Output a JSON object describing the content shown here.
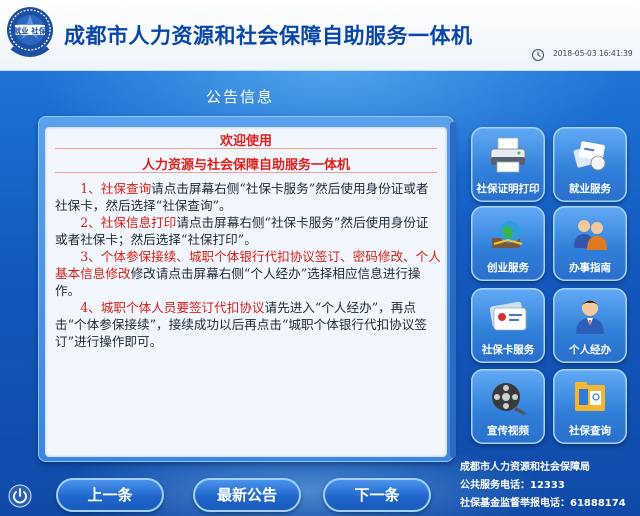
{
  "header": {
    "logo_text": "就业 社保",
    "title": "成都市人力资源和社会保障自助服务一体机",
    "datetime": "2018-05-03 16:41:39"
  },
  "notice": {
    "heading": "公告信息",
    "welcome": "欢迎使用",
    "subtitle": "人力资源与社会保障自助服务一体机",
    "items": [
      {
        "highlight": "1、社保查询",
        "text": "请点击屏幕右侧“社保卡服务”然后使用身份证或者社保卡，然后选择“社保查询”。"
      },
      {
        "highlight": "2、社保信息打印",
        "text": "请点击屏幕右侧“社保卡服务”然后使用身份证或者社保卡；然后选择“社保打印”。"
      },
      {
        "highlight": "3、个体参保接续、城职个体银行代扣协议签订、密码修改、个人基本信息修改",
        "text": "修改请点击屏幕右侧“个人经办”选择相应信息进行操作。"
      },
      {
        "highlight": "4、城职个体人员要签订代扣协议",
        "text": "请先进入“个人经办”，再点击“个体参保接续”，接续成功以后再点击“城职个体银行代扣协议签订”进行操作即可。"
      }
    ]
  },
  "tiles": [
    {
      "label": "社保证明打印",
      "icon": "printer-icon"
    },
    {
      "label": "就业服务",
      "icon": "business-card-icon"
    },
    {
      "label": "创业服务",
      "icon": "globe-icon"
    },
    {
      "label": "办事指南",
      "icon": "people-icon"
    },
    {
      "label": "社保卡服务",
      "icon": "social-card-icon"
    },
    {
      "label": "个人经办",
      "icon": "person-icon"
    },
    {
      "label": "宣传视频",
      "icon": "film-reel-icon"
    },
    {
      "label": "社保查询",
      "icon": "folder-search-icon"
    }
  ],
  "nav": {
    "prev": "上一条",
    "latest": "最新公告",
    "next": "下一条"
  },
  "footer": {
    "org": "成都市人力资源和社会保障局",
    "service_phone": "公共服务电话：12333",
    "report_phone": "社保基金监督举报电话：61888174"
  },
  "colors": {
    "title": "#0a46a8",
    "highlight_red": "#d82014",
    "panel_blue": "#3b86e0"
  }
}
